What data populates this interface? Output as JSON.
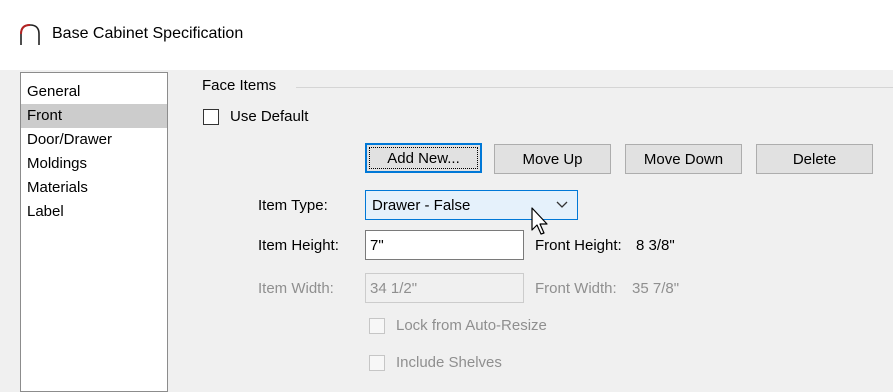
{
  "window": {
    "title": "Base Cabinet Specification",
    "icon": "arch-icon"
  },
  "sidebar": {
    "items": [
      {
        "label": "General",
        "selected": false
      },
      {
        "label": "Front",
        "selected": true
      },
      {
        "label": "Door/Drawer",
        "selected": false
      },
      {
        "label": "Moldings",
        "selected": false
      },
      {
        "label": "Materials",
        "selected": false
      },
      {
        "label": "Label",
        "selected": false
      }
    ]
  },
  "face_items": {
    "group_label": "Face Items",
    "use_default": {
      "label": "Use Default",
      "checked": false
    },
    "buttons": {
      "add_new": "Add New...",
      "move_up": "Move Up",
      "move_down": "Move Down",
      "delete": "Delete"
    },
    "item_type": {
      "label": "Item Type:",
      "value": "Drawer - False"
    },
    "item_height": {
      "label": "Item Height:",
      "value": "7\""
    },
    "front_height": {
      "label": "Front Height:",
      "value": "8 3/8\""
    },
    "item_width": {
      "label": "Item Width:",
      "value": "34 1/2\""
    },
    "front_width": {
      "label": "Front Width:",
      "value": "35 7/8\""
    },
    "lock_auto_resize": {
      "label": "Lock from Auto-Resize",
      "checked": false
    },
    "include_shelves": {
      "label": "Include Shelves",
      "checked": false
    }
  },
  "colors": {
    "accent": "#0078d7",
    "select_bg": "#e5f1fb",
    "selected_item_bg": "#cccccc",
    "disabled_text": "#8f8f8f"
  }
}
